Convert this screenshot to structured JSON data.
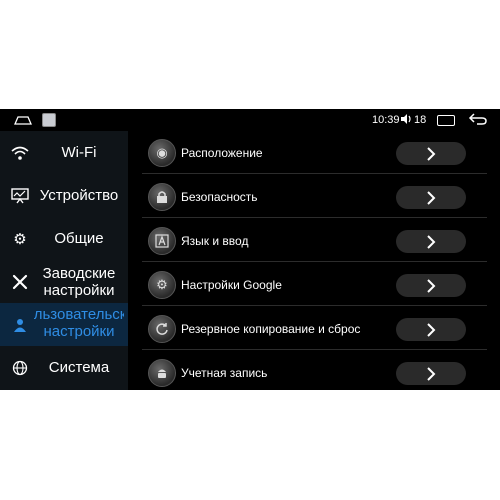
{
  "status_bar": {
    "time": "10:39",
    "volume_level": "18"
  },
  "sidebar": {
    "items": [
      {
        "label": "Wi-Fi",
        "icon": "wifi-icon"
      },
      {
        "label": "Устройство",
        "icon": "monitor-icon"
      },
      {
        "label": "Общие",
        "icon": "gear-icon"
      },
      {
        "label": "Заводские настройки",
        "icon": "tools-icon"
      },
      {
        "label": "Пользовательские настройки",
        "icon": "user-icon",
        "active": true
      },
      {
        "label": "Система",
        "icon": "globe-icon"
      }
    ]
  },
  "settings": {
    "rows": [
      {
        "label": "Расположение",
        "icon": "location-icon"
      },
      {
        "label": "Безопасность",
        "icon": "lock-icon"
      },
      {
        "label": "Язык и ввод",
        "icon": "language-icon"
      },
      {
        "label": "Настройки Google",
        "icon": "google-settings-icon"
      },
      {
        "label": "Резервное копирование и сброс",
        "icon": "backup-icon"
      },
      {
        "label": "Учетная запись",
        "icon": "android-icon"
      }
    ]
  },
  "colors": {
    "background": "#000000",
    "sidebar_bg": "#0f1418",
    "active_bg": "#0c2740",
    "accent": "#2f8de4",
    "button_bg": "#2a2a2a"
  }
}
